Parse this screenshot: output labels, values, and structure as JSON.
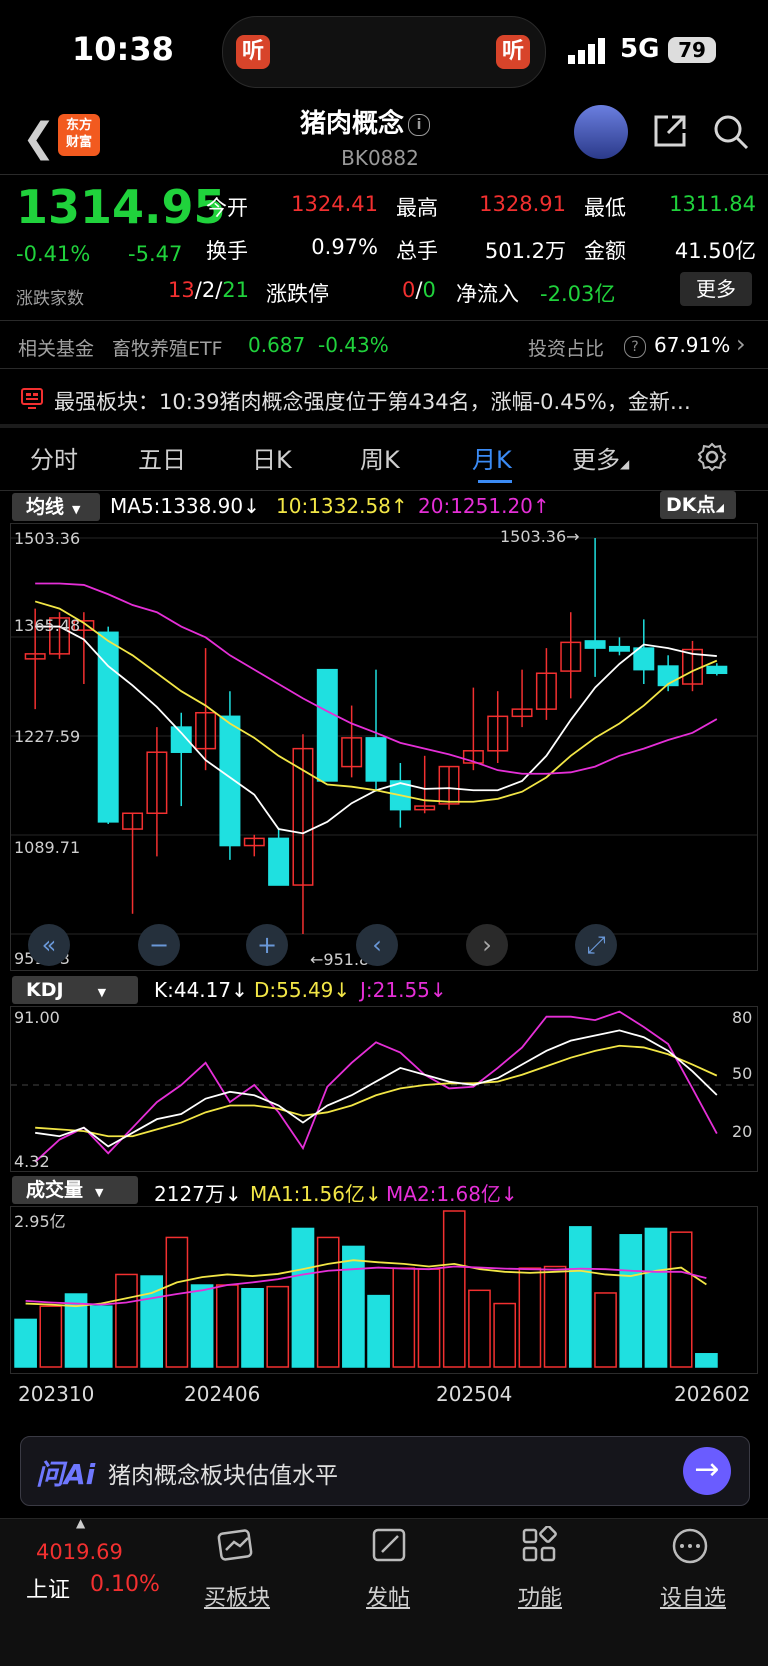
{
  "status_bar": {
    "time": "10:38",
    "network": "5G",
    "battery": "79",
    "listen_label": "听"
  },
  "header": {
    "title": "猪肉概念",
    "code": "BK0882",
    "logo_text_1": "东方",
    "logo_text_2": "财富"
  },
  "quote": {
    "price": "1314.95",
    "change_pct": "-0.41%",
    "change": "-5.47",
    "open_label": "今开",
    "open": "1324.41",
    "high_label": "最高",
    "high": "1328.91",
    "low_label": "最低",
    "low": "1311.84",
    "turnover_label": "换手",
    "turnover": "0.97%",
    "volume_label": "总手",
    "volume": "501.2万",
    "amount_label": "金额",
    "amount": "41.50亿",
    "advdec_label": "涨跌家数",
    "adv": "13",
    "flat": "2",
    "dec": "21",
    "slash": "/",
    "limit_label": "涨跌停",
    "limit_up": "0",
    "limit_down": "0",
    "netflow_label": "净流入",
    "netflow": "-2.03亿",
    "more_label": "更多"
  },
  "fund": {
    "label": "相关基金",
    "name": "畜牧养殖ETF",
    "price": "0.687",
    "pct": "-0.43%",
    "ratio_label": "投资占比",
    "ratio": "67.91%"
  },
  "news": {
    "text": "最强板块：10:39猪肉概念强度位于第434名，涨幅-0.45%，金新…"
  },
  "tabs": [
    "分时",
    "五日",
    "日K",
    "周K",
    "月K",
    "更多"
  ],
  "active_tab": 4,
  "ma_legend": {
    "dropdown": "均线",
    "ma5": "MA5:1338.90↓",
    "ma10": "10:1332.58↑",
    "ma20": "20:1251.20↑",
    "dk": "DK点"
  },
  "kdj_legend": {
    "dropdown": "KDJ",
    "k": "K:44.17↓",
    "d": "D:55.49↓",
    "j": "J:21.55↓"
  },
  "vol_legend": {
    "dropdown": "成交量",
    "vol": "2127万↓",
    "ma1": "MA1:1.56亿↓",
    "ma2": "MA2:1.68亿↓"
  },
  "colors": {
    "up": "#f23030",
    "down": "#1fe0e0",
    "ma5": "#ffffff",
    "ma10": "#f2e646",
    "ma20": "#e52fd7",
    "accent": "#3b8bf5",
    "green": "#20d23c"
  },
  "chart_data": [
    {
      "type": "candlestick",
      "y_ticks": [
        "1503.36",
        "1365.48",
        "1227.59",
        "1089.71",
        "951.83"
      ],
      "annotations": [
        "1503.36→",
        "←951.83"
      ],
      "ylim": [
        951.83,
        1503.36
      ],
      "candles": [
        {
          "o": 1335,
          "h": 1405,
          "l": 1265,
          "c": 1342
        },
        {
          "o": 1342,
          "h": 1400,
          "l": 1335,
          "c": 1392
        },
        {
          "o": 1375,
          "h": 1400,
          "l": 1300,
          "c": 1388
        },
        {
          "o": 1372,
          "h": 1380,
          "l": 1105,
          "c": 1108
        },
        {
          "o": 1098,
          "h": 1120,
          "l": 980,
          "c": 1120
        },
        {
          "o": 1120,
          "h": 1240,
          "l": 1060,
          "c": 1205
        },
        {
          "o": 1240,
          "h": 1260,
          "l": 1130,
          "c": 1205
        },
        {
          "o": 1210,
          "h": 1350,
          "l": 1180,
          "c": 1260
        },
        {
          "o": 1255,
          "h": 1290,
          "l": 1055,
          "c": 1075
        },
        {
          "o": 1075,
          "h": 1090,
          "l": 1060,
          "c": 1085
        },
        {
          "o": 1085,
          "h": 1100,
          "l": 1025,
          "c": 1020
        },
        {
          "o": 1020,
          "h": 1230,
          "l": 951.83,
          "c": 1210
        },
        {
          "o": 1320,
          "h": 1320,
          "l": 1180,
          "c": 1165
        },
        {
          "o": 1185,
          "h": 1270,
          "l": 1170,
          "c": 1225
        },
        {
          "o": 1225,
          "h": 1320,
          "l": 1150,
          "c": 1165
        },
        {
          "o": 1165,
          "h": 1190,
          "l": 1100,
          "c": 1125
        },
        {
          "o": 1125,
          "h": 1200,
          "l": 1120,
          "c": 1130
        },
        {
          "o": 1133,
          "h": 1185,
          "l": 1125,
          "c": 1185
        },
        {
          "o": 1190,
          "h": 1295,
          "l": 1180,
          "c": 1207
        },
        {
          "o": 1207,
          "h": 1290,
          "l": 1190,
          "c": 1255
        },
        {
          "o": 1255,
          "h": 1320,
          "l": 1240,
          "c": 1265
        },
        {
          "o": 1265,
          "h": 1350,
          "l": 1250,
          "c": 1315
        },
        {
          "o": 1318,
          "h": 1400,
          "l": 1280,
          "c": 1358
        },
        {
          "o": 1360,
          "h": 1503.36,
          "l": 1310,
          "c": 1350
        },
        {
          "o": 1352,
          "h": 1365,
          "l": 1340,
          "c": 1346
        },
        {
          "o": 1350,
          "h": 1390,
          "l": 1300,
          "c": 1320
        },
        {
          "o": 1325,
          "h": 1340,
          "l": 1290,
          "c": 1298
        },
        {
          "o": 1300,
          "h": 1360,
          "l": 1290,
          "c": 1348
        },
        {
          "o": 1324.41,
          "h": 1328.91,
          "l": 1311.84,
          "c": 1314.95
        }
      ],
      "ma5": [
        1380,
        1380,
        1362,
        1325,
        1298,
        1268,
        1232,
        1194,
        1170,
        1146,
        1098,
        1092,
        1108,
        1134,
        1152,
        1162,
        1154,
        1155,
        1152,
        1152,
        1165,
        1200,
        1250,
        1295,
        1328,
        1355,
        1350,
        1342,
        1338.9
      ],
      "ma10": [
        1415,
        1405,
        1385,
        1360,
        1340,
        1315,
        1290,
        1270,
        1245,
        1225,
        1200,
        1180,
        1160,
        1157,
        1152,
        1145,
        1138,
        1136,
        1136,
        1140,
        1150,
        1170,
        1200,
        1225,
        1245,
        1270,
        1300,
        1318,
        1332.58
      ],
      "ma20": [
        1440,
        1440,
        1438,
        1425,
        1410,
        1400,
        1380,
        1365,
        1340,
        1320,
        1300,
        1280,
        1262,
        1245,
        1232,
        1218,
        1210,
        1202,
        1192,
        1180,
        1175,
        1175,
        1177,
        1185,
        1200,
        1210,
        1222,
        1232,
        1251.2
      ]
    },
    {
      "type": "line",
      "y_ticks": [
        "91.00",
        "4.32"
      ],
      "right_ticks": [
        "80",
        "50",
        "20"
      ],
      "ylim": [
        4.32,
        91.0
      ],
      "K": [
        22,
        20,
        25,
        14,
        22,
        30,
        33,
        42,
        46,
        44,
        38,
        28,
        38,
        44,
        52,
        60,
        56,
        52,
        50,
        54,
        62,
        70,
        76,
        79,
        82,
        78,
        70,
        58,
        44.17
      ],
      "D": [
        25,
        24,
        23,
        20,
        20,
        24,
        28,
        34,
        38,
        38,
        36,
        32,
        34,
        38,
        44,
        48,
        50,
        51,
        51,
        52,
        56,
        61,
        66,
        70,
        73,
        72,
        68,
        62,
        55.49
      ],
      "J": [
        5,
        18,
        25,
        10,
        25,
        40,
        50,
        63,
        40,
        50,
        34,
        13,
        49,
        63,
        75,
        69,
        56,
        48,
        49,
        60,
        72,
        90,
        90,
        88,
        93,
        84,
        74,
        48,
        21.55
      ]
    },
    {
      "type": "bar",
      "y_ticks": [
        "2.95亿"
      ],
      "x_ticks": [
        "202310",
        "202406",
        "202504",
        "202602"
      ],
      "values": [
        0.9,
        1.15,
        1.38,
        1.15,
        1.75,
        1.72,
        2.45,
        1.55,
        1.55,
        1.48,
        1.52,
        2.62,
        2.45,
        2.28,
        1.35,
        1.87,
        1.85,
        2.95,
        1.45,
        1.2,
        1.87,
        1.9,
        2.65,
        1.4,
        2.5,
        2.62,
        2.55,
        0.25
      ],
      "up": [
        false,
        true,
        false,
        false,
        true,
        false,
        true,
        false,
        true,
        false,
        true,
        false,
        true,
        false,
        false,
        true,
        true,
        true,
        true,
        true,
        true,
        true,
        false,
        true,
        false,
        false,
        true,
        false
      ],
      "ma1": [
        1.2,
        1.18,
        1.15,
        1.2,
        1.3,
        1.4,
        1.6,
        1.7,
        1.75,
        1.72,
        1.76,
        1.85,
        1.95,
        2.02,
        1.98,
        1.95,
        1.9,
        1.95,
        1.85,
        1.8,
        1.78,
        1.8,
        1.82,
        1.75,
        1.72,
        1.82,
        1.88,
        1.56
      ],
      "ma2": [
        1.25,
        1.22,
        1.2,
        1.18,
        1.22,
        1.3,
        1.38,
        1.45,
        1.55,
        1.6,
        1.66,
        1.75,
        1.82,
        1.85,
        1.88,
        1.86,
        1.85,
        1.9,
        1.88,
        1.86,
        1.85,
        1.84,
        1.86,
        1.85,
        1.82,
        1.8,
        1.8,
        1.68
      ]
    }
  ],
  "controls": [
    "«",
    "−",
    "+",
    "‹",
    "›",
    "⤢"
  ],
  "ai": {
    "badge": "问Ai",
    "text": "猪肉概念板块估值水平"
  },
  "bottom_nav": {
    "index_value": "4019.69",
    "index_name": "上证",
    "index_pct": "0.10%",
    "items": [
      "买板块",
      "发帖",
      "功能",
      "设自选"
    ]
  }
}
